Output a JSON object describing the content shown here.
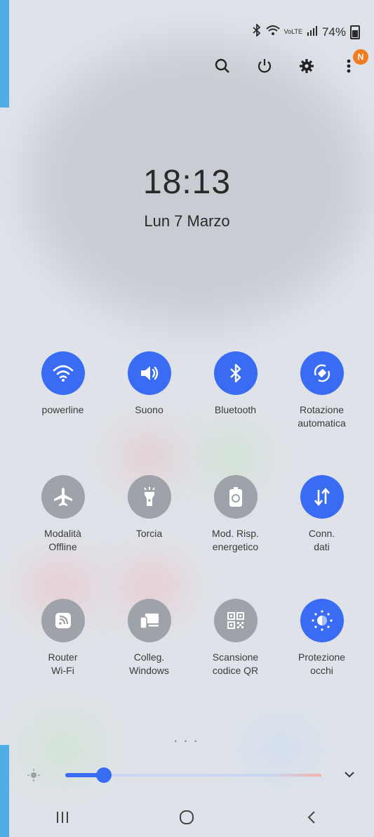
{
  "status_bar": {
    "network": "VoLTE",
    "battery": "74%"
  },
  "top_actions": {
    "notification_badge": "N"
  },
  "lock": {
    "time": "18:13",
    "date": "Lun 7 Marzo"
  },
  "tiles": [
    {
      "label": "powerline",
      "icon": "wifi-icon",
      "active": true
    },
    {
      "label": "Suono",
      "icon": "sound-icon",
      "active": true
    },
    {
      "label": "Bluetooth",
      "icon": "bluetooth-icon",
      "active": true
    },
    {
      "label": "Rotazione\nautomatica",
      "icon": "auto-rotate-icon",
      "active": true
    },
    {
      "label": "Modalità\nOffline",
      "icon": "airplane-icon",
      "active": false
    },
    {
      "label": "Torcia",
      "icon": "flashlight-icon",
      "active": false
    },
    {
      "label": "Mod. Risp.\nenergetico",
      "icon": "power-saving-icon",
      "active": false
    },
    {
      "label": "Conn.\ndati",
      "icon": "mobile-data-icon",
      "active": true
    },
    {
      "label": "Router\nWi-Fi",
      "icon": "hotspot-icon",
      "active": false
    },
    {
      "label": "Colleg.\nWindows",
      "icon": "link-windows-icon",
      "active": false
    },
    {
      "label": "Scansione\ncodice QR",
      "icon": "qr-icon",
      "active": false
    },
    {
      "label": "Protezione\nocchi",
      "icon": "eye-comfort-icon",
      "active": true
    }
  ],
  "pager": "• • •",
  "brightness": {
    "level": 0.15
  },
  "colors": {
    "active": "#3a6cf3",
    "inactive": "#9ea2a9",
    "accent_edge": "#4faee6",
    "badge": "#f17b22"
  }
}
